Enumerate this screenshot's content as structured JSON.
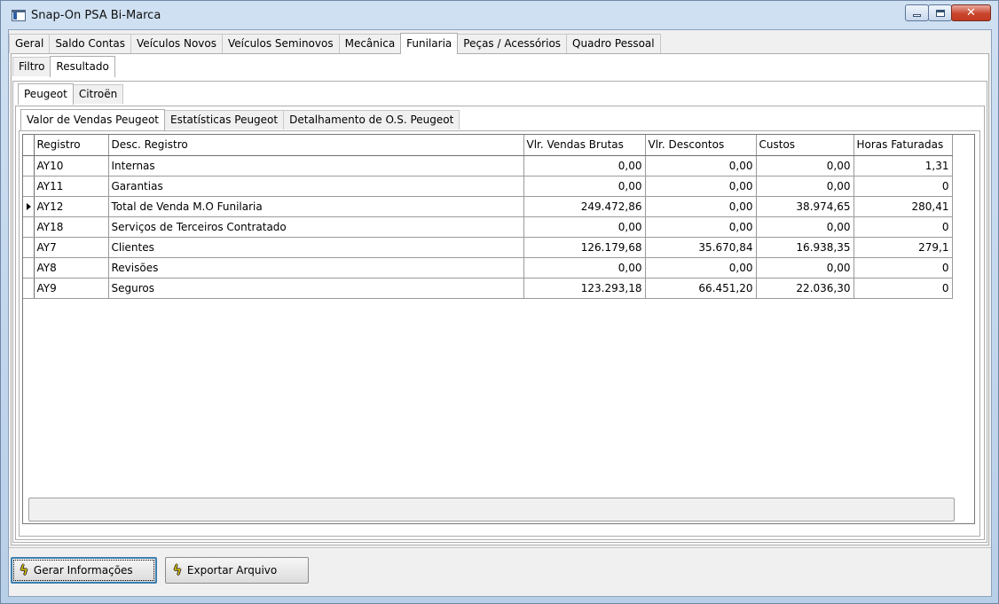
{
  "window": {
    "title": "Snap-On PSA Bi-Marca"
  },
  "main_tabs": [
    {
      "label": "Geral"
    },
    {
      "label": "Saldo Contas"
    },
    {
      "label": "Veículos Novos"
    },
    {
      "label": "Veículos Seminovos"
    },
    {
      "label": "Mecânica"
    },
    {
      "label": "Funilaria"
    },
    {
      "label": "Peças / Acessórios"
    },
    {
      "label": "Quadro Pessoal"
    }
  ],
  "sub_tabs": [
    {
      "label": "Filtro"
    },
    {
      "label": "Resultado"
    }
  ],
  "brand_tabs": [
    {
      "label": "Peugeot"
    },
    {
      "label": "Citroën"
    }
  ],
  "report_tabs": [
    {
      "label": "Valor de Vendas Peugeot"
    },
    {
      "label": "Estatísticas Peugeot"
    },
    {
      "label": "Detalhamento de O.S. Peugeot"
    }
  ],
  "table": {
    "headers": [
      "Registro",
      "Desc. Registro",
      "Vlr. Vendas Brutas",
      "Vlr. Descontos",
      "Custos",
      "Horas Faturadas"
    ],
    "current_row": 2,
    "rows": [
      [
        "AY10",
        "Internas",
        "0,00",
        "0,00",
        "0,00",
        "1,31"
      ],
      [
        "AY11",
        "Garantias",
        "0,00",
        "0,00",
        "0,00",
        "0"
      ],
      [
        "AY12",
        "Total de Venda M.O Funilaria",
        "249.472,86",
        "0,00",
        "38.974,65",
        "280,41"
      ],
      [
        "AY18",
        "Serviços de Terceiros Contratado",
        "0,00",
        "0,00",
        "0,00",
        "0"
      ],
      [
        "AY7",
        "Clientes",
        "126.179,68",
        "35.670,84",
        "16.938,35",
        "279,1"
      ],
      [
        "AY8",
        "Revisões",
        "0,00",
        "0,00",
        "0,00",
        "0"
      ],
      [
        "AY9",
        "Seguros",
        "123.293,18",
        "66.451,20",
        "22.036,30",
        "0"
      ]
    ]
  },
  "buttons": {
    "generate": "Gerar Informações",
    "export": "Exportar Arquivo"
  },
  "icons": {
    "buttons": "lightning-bolt-icon"
  }
}
